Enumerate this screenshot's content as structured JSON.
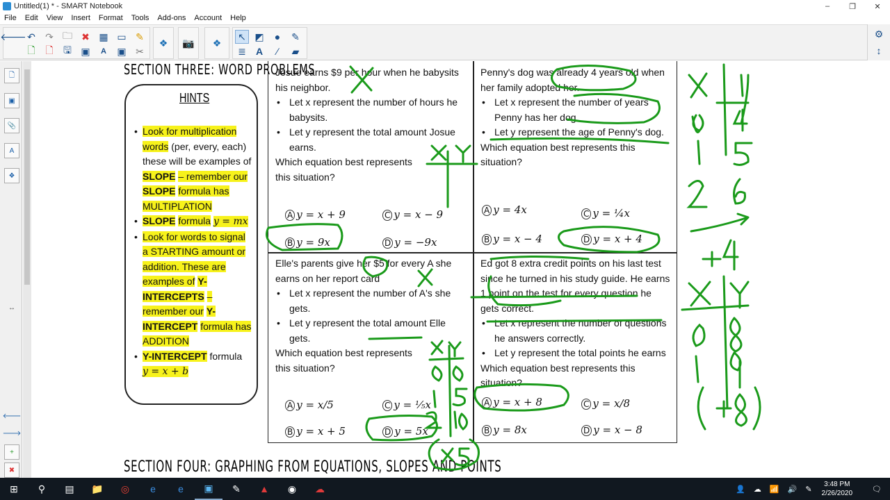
{
  "window": {
    "title": "Untitled(1) * - SMART Notebook",
    "minimize": "–",
    "restore": "❐",
    "close": "✕"
  },
  "menu": [
    "File",
    "Edit",
    "View",
    "Insert",
    "Format",
    "Tools",
    "Add-ons",
    "Account",
    "Help"
  ],
  "canvas": {
    "section_three": "SECTION THREE: WORD PROBLEMS",
    "section_four": "SECTION FOUR: GRAPHING FROM EQUATIONS, SLOPES AND POINTS",
    "hints": {
      "title": "HINTS",
      "items": [
        "Look for multiplication words",
        "(per, every, each) these will be examples of",
        "SLOPE",
        "– remember our",
        "SLOPE",
        "formula has MULTIPLATION",
        "SLOPE",
        "formula",
        "y = mx",
        "Look for words to signal a STARTING amount or addition. These are examples of",
        "Y-INTERCEPTS",
        "– remember our",
        "Y-INTERCEPT",
        "formula has ADDITION",
        "Y-INTERCEPT",
        "formula",
        "y = x + b"
      ]
    },
    "q1": {
      "stem": "Josue earns $9 per hour when he babysits his neighbor.",
      "b1": "Let x represent the number of hours he babysits.",
      "b2": "Let y represent the total amount Josue earns.",
      "ask": "Which equation best represents this situation?",
      "A": "y = x + 9",
      "B": "y = 9x",
      "C": "y = x − 9",
      "D": "y = −9x"
    },
    "q2": {
      "stem": "Penny's dog was already 4 years old when her family adopted her.",
      "b1": "Let x represent the number of years Penny has her dog.",
      "b2": "Let y represent the age of Penny's dog.",
      "ask": "Which equation best represents this situation?",
      "A": "y = 4x",
      "B": "y = x − 4",
      "C": "y = ¼x",
      "D": "y = x + 4"
    },
    "q3": {
      "stem": "Elle's parents give her $5 for every A she earns on her report card",
      "b1": "Let x represent the number of A's she gets.",
      "b2": "Let y represent the total amount Elle gets.",
      "ask": "Which equation best represents this situation?",
      "A": "y = x/5",
      "B": "y = x + 5",
      "C": "y = ⅕x",
      "D": "y = 5x"
    },
    "q4": {
      "stem": "Ed got 8 extra credit points on his last test since he turned in his study guide. He earns 1 point on the test for every question he gets correct.",
      "b1": "Let x represent the number of questions he answers correctly.",
      "b2": "Let y represent the total points he earns",
      "ask": "Which equation best represents this situation?",
      "A": "y = x + 8",
      "B": "y = 8x",
      "C": "y = x/8",
      "D": "y = x − 8"
    }
  },
  "taskbar": {
    "time": "3:48 PM",
    "date": "2/26/2020"
  },
  "colors": {
    "ink_green": "#1a9a1a",
    "highlight_yellow": "#f7f21b",
    "toolbar_bg": "#f2f2f2",
    "taskbar_bg": "#111820"
  }
}
